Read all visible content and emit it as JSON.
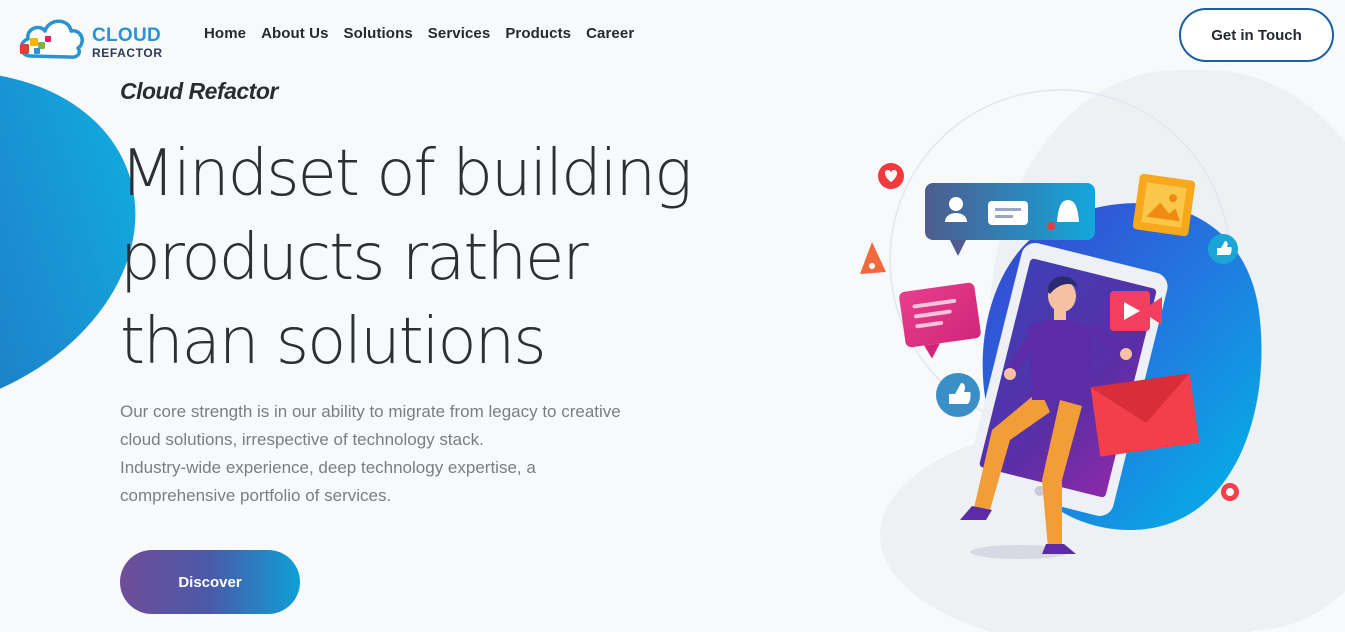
{
  "logo": {
    "line1": "CLOUD",
    "line2": "REFACTOR"
  },
  "nav": {
    "items": [
      {
        "label": "Home"
      },
      {
        "label": "About Us"
      },
      {
        "label": "Solutions"
      },
      {
        "label": "Services"
      },
      {
        "label": "Products"
      },
      {
        "label": "Career"
      }
    ]
  },
  "header": {
    "cta_label": "Get in Touch"
  },
  "hero": {
    "brand": "Cloud Refactor",
    "headline": [
      "Mindset of building",
      "products rather",
      "than solutions"
    ],
    "description": [
      "Our core strength is in our ability to migrate from legacy to creative",
      "cloud solutions, irrespective of technology stack.",
      "Industry-wide experience, deep technology expertise, a",
      "comprehensive portfolio of services."
    ],
    "button_label": "Discover"
  },
  "colors": {
    "accent_blue": "#1d5fa3",
    "gradient_start": "#6f4d98",
    "gradient_end": "#0ea0d6",
    "logo_blue": "#2b93d1"
  },
  "icons": [
    "cloud-logo-icon",
    "heart-icon",
    "user-icon",
    "chat-icon",
    "bell-icon",
    "image-icon",
    "like-icon",
    "play-icon",
    "music-icon",
    "mail-icon",
    "record-icon"
  ]
}
